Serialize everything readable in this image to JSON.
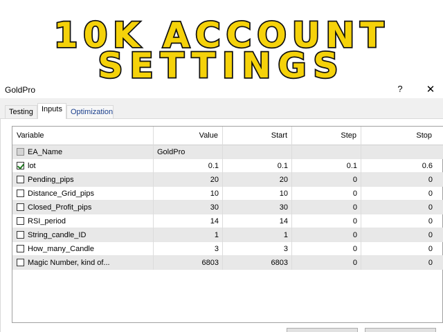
{
  "banner": {
    "line1": "10K ACCOUNT",
    "line2": "SETTINGS",
    "fill_color": "#f5d20a",
    "outline_color": "#111111"
  },
  "dialog": {
    "title": "GoldPro",
    "help_label": "?",
    "close_label": "✕"
  },
  "tabs": [
    {
      "label": "Testing",
      "active": false
    },
    {
      "label": "Inputs",
      "active": true
    },
    {
      "label": "Optimization",
      "active": false
    }
  ],
  "table": {
    "headers": [
      "Variable",
      "Value",
      "Start",
      "Step",
      "Stop"
    ],
    "rows": [
      {
        "name": "EA_Name",
        "checked": false,
        "disabled": true,
        "value": "GoldPro",
        "start": "",
        "step": "",
        "stop": ""
      },
      {
        "name": "lot",
        "checked": true,
        "disabled": false,
        "value": "0.1",
        "start": "0.1",
        "step": "0.1",
        "stop": "0.6"
      },
      {
        "name": "Pending_pips",
        "checked": false,
        "disabled": false,
        "value": "20",
        "start": "20",
        "step": "0",
        "stop": "0"
      },
      {
        "name": "Distance_Grid_pips",
        "checked": false,
        "disabled": false,
        "value": "10",
        "start": "10",
        "step": "0",
        "stop": "0"
      },
      {
        "name": "Closed_Profit_pips",
        "checked": false,
        "disabled": false,
        "value": "30",
        "start": "30",
        "step": "0",
        "stop": "0"
      },
      {
        "name": "RSI_period",
        "checked": false,
        "disabled": false,
        "value": "14",
        "start": "14",
        "step": "0",
        "stop": "0"
      },
      {
        "name": "String_candle_ID",
        "checked": false,
        "disabled": false,
        "value": "1",
        "start": "1",
        "step": "0",
        "stop": "0"
      },
      {
        "name": "How_many_Candle",
        "checked": false,
        "disabled": false,
        "value": "3",
        "start": "3",
        "step": "0",
        "stop": "0"
      },
      {
        "name": "Magic Number, kind of...",
        "checked": false,
        "disabled": false,
        "value": "6803",
        "start": "6803",
        "step": "0",
        "stop": "0"
      }
    ]
  }
}
